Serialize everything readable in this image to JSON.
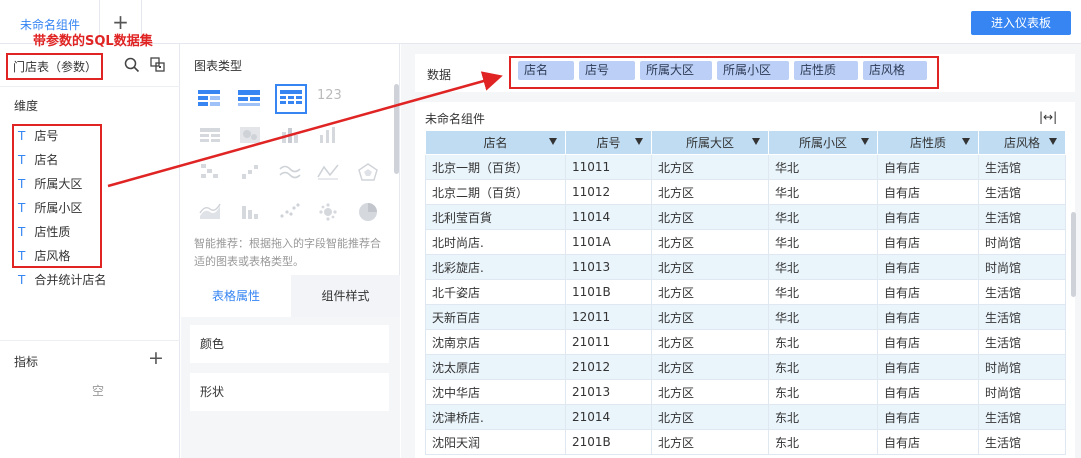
{
  "tabs": {
    "active": "未命名组件",
    "add": "+"
  },
  "header": {
    "enter_dashboard": "进入仪表板"
  },
  "annotation": {
    "title": "带参数的SQL数据集"
  },
  "left_panel": {
    "dataset_name": "门店表（参数）",
    "dimension_label": "维度",
    "dimensions": [
      "店号",
      "店名",
      "所属大区",
      "所属小区",
      "店性质",
      "店风格",
      "合并统计店名"
    ],
    "type_glyph": "T",
    "metric_label": "指标",
    "metric_add": "+",
    "metric_empty": "空"
  },
  "middle_panel": {
    "chart_type_label": "图表类型",
    "number_glyph": "123",
    "tip": "智能推荐：根据拖入的字段智能推荐合适的图表或表格类型。",
    "tabs": {
      "table_props": "表格属性",
      "component_style": "组件样式"
    },
    "props": [
      "颜色",
      "形状"
    ]
  },
  "right_panel": {
    "data_label": "数据",
    "data_fields": [
      "店名",
      "店号",
      "所属大区",
      "所属小区",
      "店性质",
      "店风格"
    ],
    "widget_title": "未命名组件",
    "expand_icon": "|↔|",
    "table": {
      "headers": [
        "店名",
        "店号",
        "所属大区",
        "所属小区",
        "店性质",
        "店风格"
      ],
      "rows": [
        [
          "北京一期（百货）",
          "11011",
          "北方区",
          "华北",
          "自有店",
          "生活馆"
        ],
        [
          "北京二期（百货）",
          "11012",
          "北方区",
          "华北",
          "自有店",
          "生活馆"
        ],
        [
          "北利莹百貨",
          "11014",
          "北方区",
          "华北",
          "自有店",
          "生活馆"
        ],
        [
          "北时尚店.",
          "1101A",
          "北方区",
          "华北",
          "自有店",
          "时尚馆"
        ],
        [
          "北彩旋店.",
          "11013",
          "北方区",
          "华北",
          "自有店",
          "时尚馆"
        ],
        [
          "北千姿店",
          "1101B",
          "北方区",
          "华北",
          "自有店",
          "生活馆"
        ],
        [
          "天新百店",
          "12011",
          "北方区",
          "华北",
          "自有店",
          "生活馆"
        ],
        [
          "沈南京店",
          "21011",
          "北方区",
          "东北",
          "自有店",
          "生活馆"
        ],
        [
          "沈太原店",
          "21012",
          "北方区",
          "东北",
          "自有店",
          "时尚馆"
        ],
        [
          "沈中华店",
          "21013",
          "北方区",
          "东北",
          "自有店",
          "时尚馆"
        ],
        [
          "沈津桥店.",
          "21014",
          "北方区",
          "东北",
          "自有店",
          "生活馆"
        ],
        [
          "沈阳天润",
          "2101B",
          "北方区",
          "东北",
          "自有店",
          "生活馆"
        ]
      ]
    }
  },
  "colors": {
    "accent": "#3685f2",
    "annotation": "#e02424",
    "pill": "#bcd0f7",
    "table_header": "#bfdcf2",
    "row_alt": "#eaf4fb"
  }
}
